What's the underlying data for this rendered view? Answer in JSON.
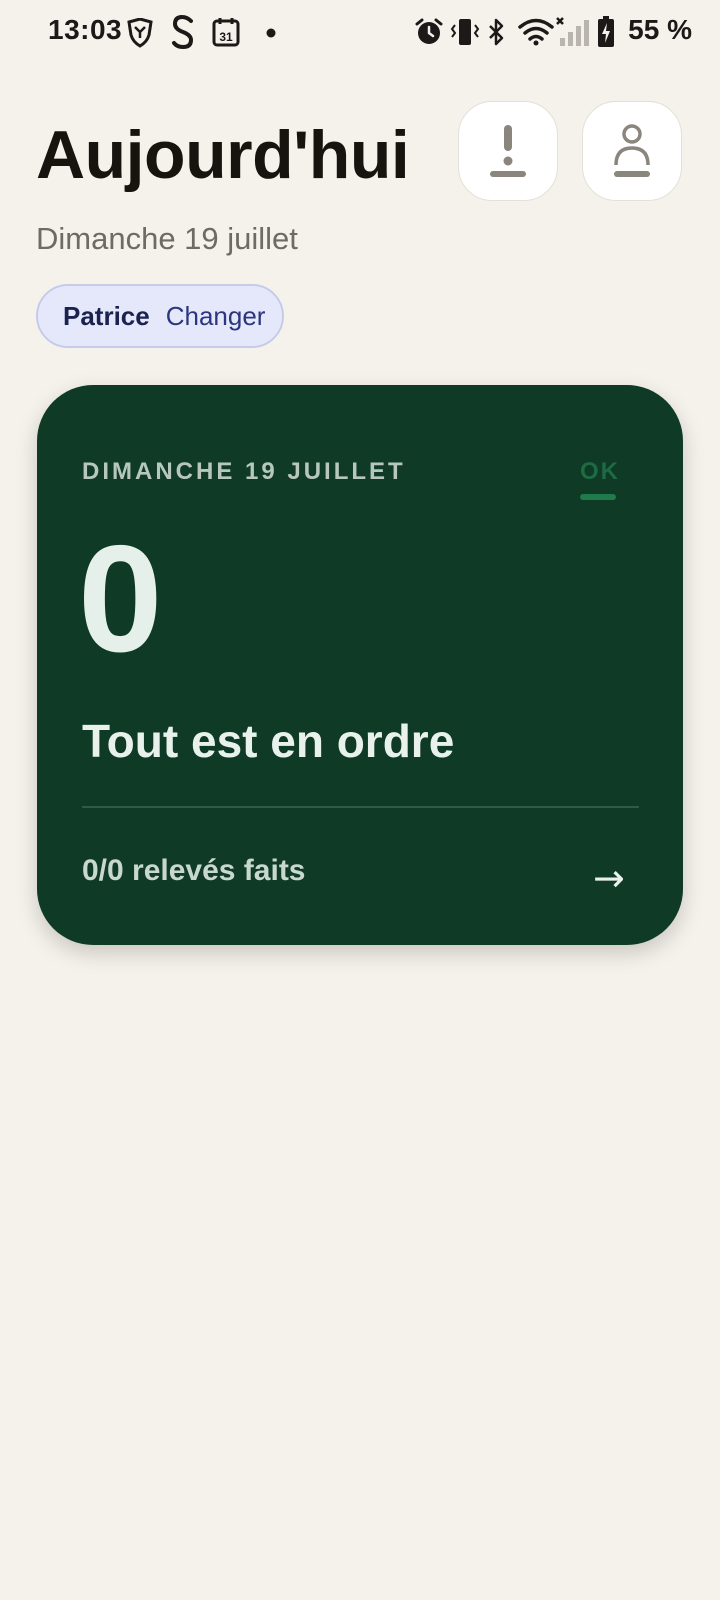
{
  "status_bar": {
    "time": "13:03",
    "battery": "55 %",
    "icons": [
      "brave-icon",
      "s-app-icon",
      "calendar-31-icon",
      "notification-dot-icon",
      "alarm-icon",
      "vibrate-icon",
      "bluetooth-icon",
      "wifi-icon",
      "signal-icon",
      "battery-charging-icon"
    ],
    "calendar_day": "31"
  },
  "header": {
    "title": "Aujourd'hui",
    "date": "Dimanche 19 juillet",
    "buttons": [
      "alert-icon",
      "profile-icon"
    ]
  },
  "user_pill": {
    "name": "Patrice",
    "action": "Changer"
  },
  "summary_card": {
    "date": "DIMANCHE 19 JUILLET",
    "status": "OK",
    "count": "0",
    "message": "Tout est en ordre",
    "progress": "0/0 relevés faits",
    "arrow": "→",
    "colors": {
      "background": "#0f3a26",
      "status": "#1d6a43"
    }
  },
  "colors": {
    "page_background": "#f5f1eb",
    "pill_background": "#e5e8fb"
  }
}
